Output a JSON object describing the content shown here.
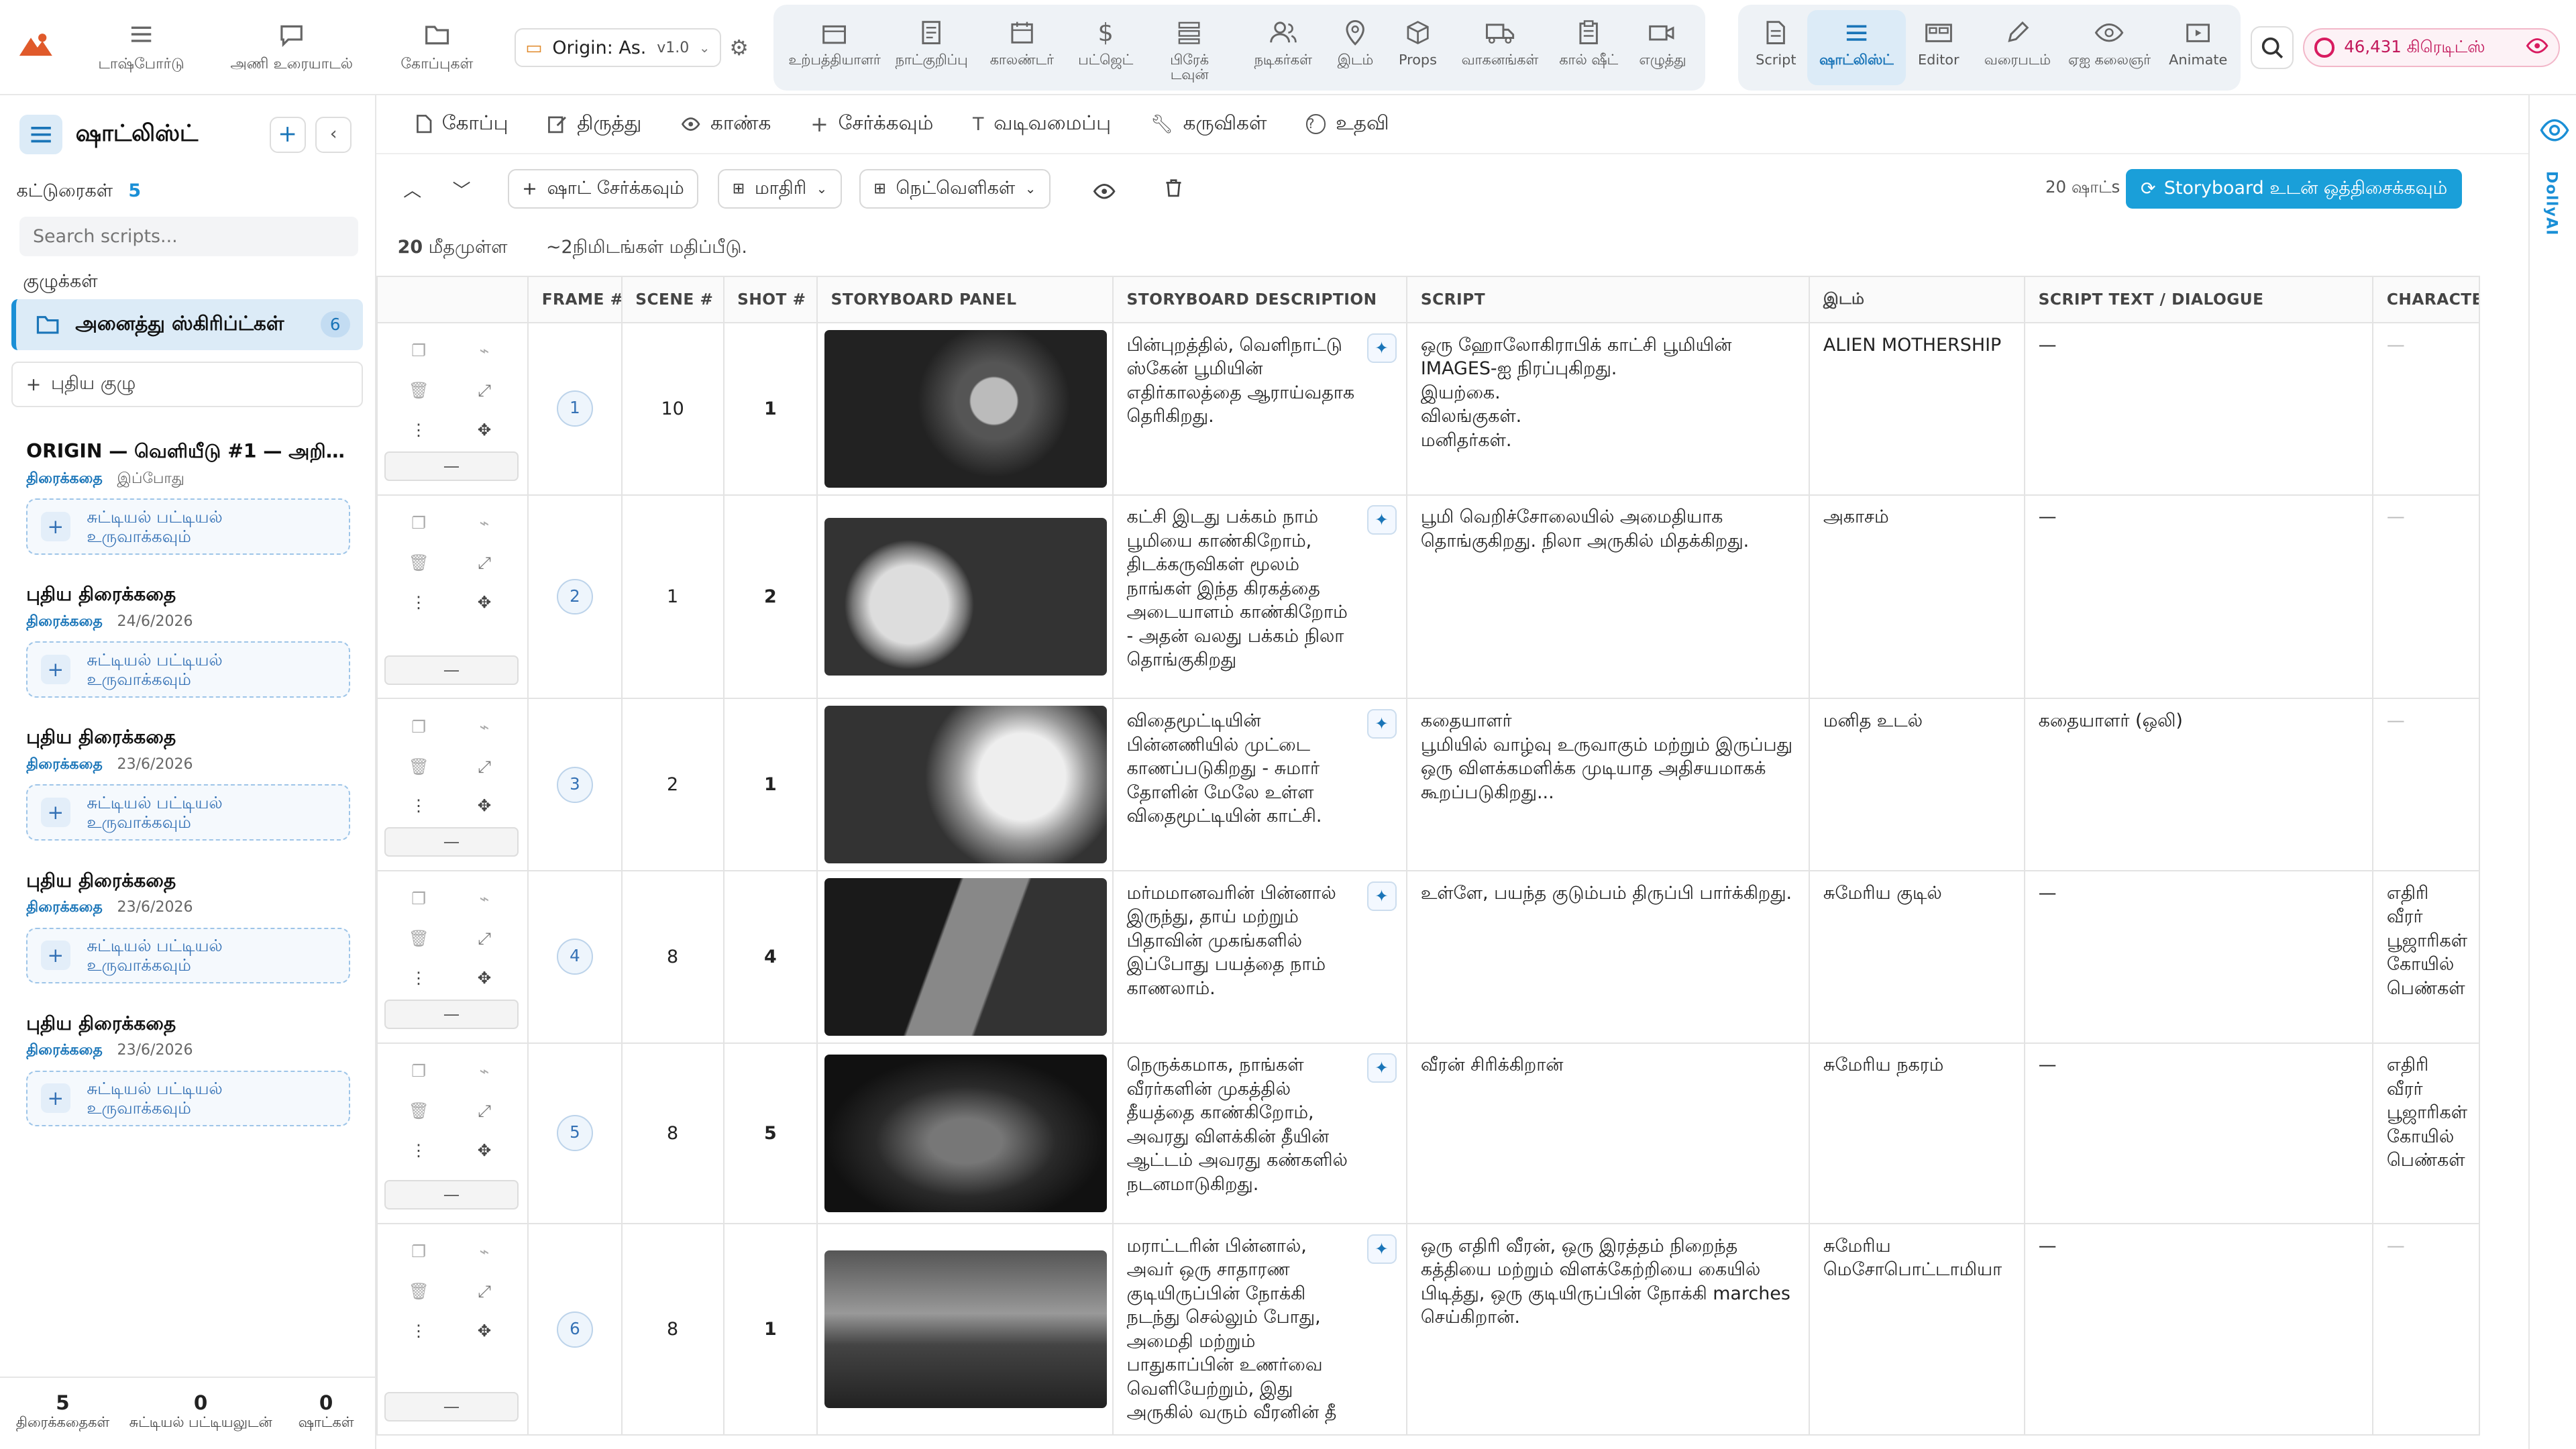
{
  "topnav": {
    "items": [
      {
        "id": "dashboard",
        "label": "டாஷ்போர்டு"
      },
      {
        "id": "team",
        "label": "அணி உரையாடல்"
      },
      {
        "id": "files",
        "label": "கோப்புகள்"
      }
    ],
    "project": {
      "name": "Origin: As...",
      "version": "v1.0"
    },
    "group1": [
      {
        "id": "production",
        "label": "உற்பத்தியாளர்"
      },
      {
        "id": "notes",
        "label": "நாட்குறிப்பு"
      },
      {
        "id": "calendar",
        "label": "காலண்டர்"
      },
      {
        "id": "budget",
        "label": "பட்ஜெட்"
      },
      {
        "id": "breakdown",
        "label": "பிரேக் டவுன்"
      },
      {
        "id": "cast",
        "label": "நடிகர்கள்"
      },
      {
        "id": "location",
        "label": "இடம்"
      },
      {
        "id": "props",
        "label": "Props"
      },
      {
        "id": "vehicles",
        "label": "வாகனங்கள்"
      },
      {
        "id": "callsheet",
        "label": "கால் ஷீட்"
      },
      {
        "id": "writing",
        "label": "எழுத்து"
      }
    ],
    "group2": [
      {
        "id": "script",
        "label": "Script"
      },
      {
        "id": "shotlist",
        "label": "ஷாட்லிஸ்ட்"
      },
      {
        "id": "editor",
        "label": "Editor"
      },
      {
        "id": "drawing",
        "label": "வரைபடம்"
      },
      {
        "id": "ai",
        "label": "ஏஐ கலைஞர்"
      },
      {
        "id": "animate",
        "label": "Animate"
      }
    ],
    "credits": "46,431 கிரெடிட்ஸ்"
  },
  "sidebar": {
    "title": "ஷாட்லிஸ்ட்",
    "essays_label": "கட்டுரைகள்",
    "essays_count": "5",
    "search_placeholder": "Search scripts...",
    "groups_label": "குழுக்கள்",
    "all_scripts": "அனைத்து ஸ்கிரிப்ட்கள்",
    "all_scripts_count": "6",
    "new_group": "புதிய குழு",
    "scripts": [
      {
        "title": "ORIGIN — வெளியீடு #1 — அறிமு...",
        "type": "திரைக்கதை",
        "date": "இப்போது",
        "cta": "சுட்டியல் பட்டியல் உருவாக்கவும்"
      },
      {
        "title": "புதிய திரைக்கதை",
        "type": "திரைக்கதை",
        "date": "24/6/2026",
        "cta": "சுட்டியல் பட்டியல் உருவாக்கவும்"
      },
      {
        "title": "புதிய திரைக்கதை",
        "type": "திரைக்கதை",
        "date": "23/6/2026",
        "cta": "சுட்டியல் பட்டியல் உருவாக்கவும்"
      },
      {
        "title": "புதிய திரைக்கதை",
        "type": "திரைக்கதை",
        "date": "23/6/2026",
        "cta": "சுட்டியல் பட்டியல் உருவாக்கவும்"
      },
      {
        "title": "புதிய திரைக்கதை",
        "type": "திரைக்கதை",
        "date": "23/6/2026",
        "cta": "சுட்டியல் பட்டியல் உருவாக்கவும்"
      }
    ],
    "stats": [
      {
        "value": "5",
        "label": "திரைக்கதைகள்"
      },
      {
        "value": "0",
        "label": "சுட்டியல் பட்டியலுடன்"
      },
      {
        "value": "0",
        "label": "ஷாட்கள்"
      }
    ]
  },
  "menu": [
    "கோப்பு",
    "திருத்து",
    "காண்க",
    "சேர்க்கவும்",
    "வடிவமைப்பு",
    "கருவிகள்",
    "உதவி"
  ],
  "toolbar": {
    "add_shot": "ஷாட் சேர்க்கவும்",
    "template": "மாதிரி",
    "columns": "நெட்வெளிகள்",
    "shots_count": "20 ஷாட்s",
    "sync": "Storyboard உடன் ஒத்திசைக்கவும்"
  },
  "meta": {
    "remaining": "20",
    "remaining_label": "மீதமுள்ள",
    "estimate": "~2நிமிடங்கள் மதிப்பீடு."
  },
  "table": {
    "headers": [
      "FRAME #",
      "SCENE #",
      "SHOT #",
      "STORYBOARD PANEL",
      "STORYBOARD DESCRIPTION",
      "SCRIPT",
      "இடம்",
      "SCRIPT TEXT / DIALOGUE",
      "CHARACTER"
    ],
    "rows": [
      {
        "frame": "1",
        "scene": "10",
        "shot": "1",
        "desc": "பின்புறத்தில், வெளிநாட்டு ஸ்கேன் பூமியின் எதிர்காலத்தை ஆராய்வதாக தெரிகிறது.",
        "script": "ஒரு ஹோலோகிராபிக் காட்சி பூமியின் IMAGES-ஐ நிரப்புகிறது.\nஇயற்கை.\nவிலங்குகள்.\nமனிதர்கள்.",
        "location": "ALIEN MOTHERSHIP",
        "dialogue": "—",
        "character": "—"
      },
      {
        "frame": "2",
        "scene": "1",
        "shot": "2",
        "desc": "கட்சி இடது பக்கம் நாம் பூமியை காண்கிறோம், திடக்கருவிகள் மூலம் நாங்கள் இந்த கிரகத்தை அடையாளம் காண்கிறோம் - அதன் வலது பக்கம் நிலா தொங்குகிறது",
        "script": "பூமி வெறிச்சோலையில் அமைதியாக தொங்குகிறது. நிலா அருகில் மிதக்கிறது.",
        "location": "அகாசம்",
        "dialogue": "—",
        "character": "—"
      },
      {
        "frame": "3",
        "scene": "2",
        "shot": "1",
        "desc": "விதைமூட்டியின் பின்னணியில் முட்டை காணப்படுகிறது - சுமார் தோளின் மேலே உள்ள விதைமூட்டியின் காட்சி.",
        "script": "கதையாளர்\nபூமியில் வாழ்வு உருவாகும் மற்றும் இருப்பது ஒரு விளக்கமளிக்க முடியாத அதிசயமாகக் கூறப்படுகிறது...",
        "location": "மனித உடல்",
        "dialogue": "கதையாளர் (ஒலி)",
        "character": "—"
      },
      {
        "frame": "4",
        "scene": "8",
        "shot": "4",
        "desc": "மர்மமானவரின் பின்னால் இருந்து, தாய் மற்றும் பிதாவின் முகங்களில் இப்போது பயத்தை நாம் காணலாம்.",
        "script": "உள்ளே, பயந்த குடும்பம் திருப்பி பார்க்கிறது.",
        "location": "சுமேரிய குடில்",
        "dialogue": "—",
        "character": "எதிரி வீரர் பூஜாரிகள் கோயில் பெண்கள்"
      },
      {
        "frame": "5",
        "scene": "8",
        "shot": "5",
        "desc": "நெருக்கமாக, நாங்கள் வீரர்களின் முகத்தில் தீயத்தை காண்கிறோம், அவரது விளக்கின் தீயின் ஆட்டம் அவரது கண்களில் நடனமாடுகிறது.",
        "script": "வீரன் சிரிக்கிறான்",
        "location": "சுமேரிய நகரம்",
        "dialogue": "—",
        "character": "எதிரி வீரர் பூஜாரிகள் கோயில் பெண்கள்"
      },
      {
        "frame": "6",
        "scene": "8",
        "shot": "1",
        "desc": "மராட்டரின் பின்னால், அவர் ஒரு சாதாரண குடியிருப்பின் நோக்கி நடந்து செல்லும் போது, அமைதி மற்றும் பாதுகாப்பின் உணர்வை வெளியேற்றும், இது அருகில் வரும் வீரனின் தீ",
        "script": "ஒரு எதிரி வீரன், ஒரு இரத்தம் நிறைந்த கத்தியை மற்றும் விளக்கேற்றியை கையில் பிடித்து, ஒரு குடியிருப்பின் நோக்கி marches செய்கிறான்.",
        "location": "சுமேரிய மெசோபொட்டாமியா",
        "dialogue": "—",
        "character": "—"
      }
    ]
  },
  "rail_label": "DollyAI",
  "colors": {
    "accent": "#1a8fd6",
    "primary_text": "#222222",
    "brand": "#e05a2b"
  }
}
